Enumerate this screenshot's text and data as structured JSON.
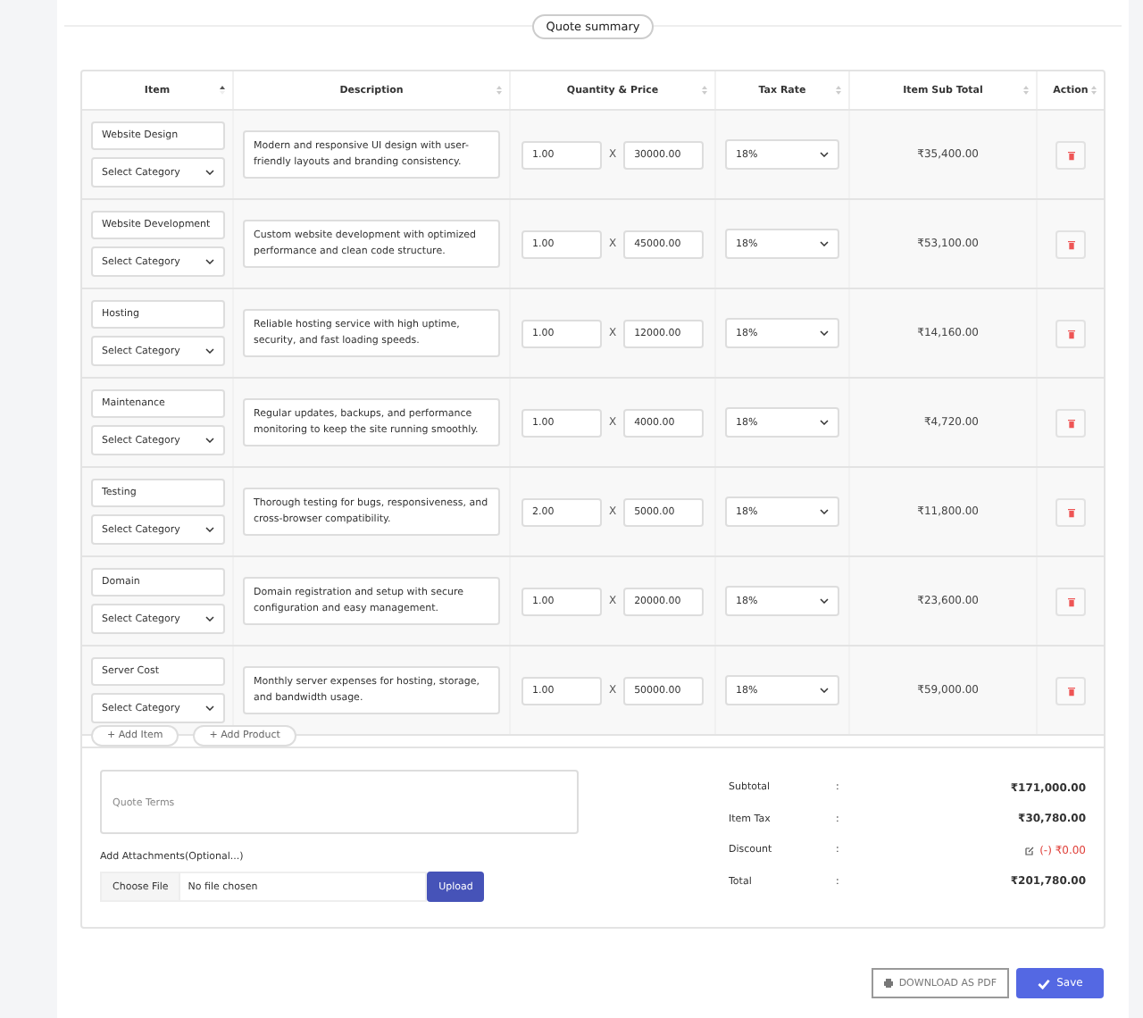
{
  "section_title": "Quote summary",
  "columns": [
    {
      "label": "Item",
      "sorted": true
    },
    {
      "label": "Description",
      "sorted": false
    },
    {
      "label": "Quantity & Price",
      "sorted": false
    },
    {
      "label": "Tax Rate",
      "sorted": false
    },
    {
      "label": "Item Sub Total",
      "sorted": false
    },
    {
      "label": "Action",
      "sorted": false
    }
  ],
  "rows": [
    {
      "item": "Website Design",
      "category": "Select Category",
      "description": "Modern and responsive UI design with user-friendly layouts and branding consistency.",
      "quantity": "1.00",
      "times": "X",
      "price": "30000.00",
      "tax": "18%",
      "subtotal": "₹35,400.00"
    },
    {
      "item": "Website Development",
      "category": "Select Category",
      "description": "Custom website development with optimized performance and clean code structure.",
      "quantity": "1.00",
      "times": "X",
      "price": "45000.00",
      "tax": "18%",
      "subtotal": "₹53,100.00"
    },
    {
      "item": "Hosting",
      "category": "Select Category",
      "description": "Reliable hosting service with high uptime, security, and fast loading speeds.",
      "quantity": "1.00",
      "times": "X",
      "price": "12000.00",
      "tax": "18%",
      "subtotal": "₹14,160.00"
    },
    {
      "item": "Maintenance",
      "category": "Select Category",
      "description": "Regular updates, backups, and performance monitoring to keep the site running smoothly.",
      "quantity": "1.00",
      "times": "X",
      "price": "4000.00",
      "tax": "18%",
      "subtotal": "₹4,720.00"
    },
    {
      "item": "Testing",
      "category": "Select Category",
      "description": "Thorough testing for bugs, responsiveness, and cross-browser compatibility.",
      "quantity": "2.00",
      "times": "X",
      "price": "5000.00",
      "tax": "18%",
      "subtotal": "₹11,800.00"
    },
    {
      "item": "Domain",
      "category": "Select Category",
      "description": "Domain registration and setup with secure configuration and easy management.",
      "quantity": "1.00",
      "times": "X",
      "price": "20000.00",
      "tax": "18%",
      "subtotal": "₹23,600.00"
    },
    {
      "item": "Server Cost",
      "category": "Select Category",
      "description": "Monthly server expenses for hosting, storage, and bandwidth usage.",
      "quantity": "1.00",
      "times": "X",
      "price": "50000.00",
      "tax": "18%",
      "subtotal": "₹59,000.00"
    }
  ],
  "add_buttons": [
    "+ Add Item",
    "+ Add Product"
  ],
  "terms": {
    "placeholder": "Quote Terms"
  },
  "attachments": {
    "label": "Add Attachments(Optional...)",
    "choose": "Choose File",
    "file": "No file chosen",
    "upload": "Upload"
  },
  "totals": [
    {
      "kind": "plain",
      "label": "Subtotal",
      "sep": ":",
      "value": "₹171,000.00"
    },
    {
      "kind": "plain",
      "label": "Item Tax",
      "sep": ":",
      "value": "₹30,780.00"
    },
    {
      "kind": "discount",
      "label": "Discount",
      "sep": ":",
      "value": "(-) ₹0.00"
    },
    {
      "kind": "plain",
      "label": "Total",
      "sep": ":",
      "value": "₹201,780.00"
    }
  ],
  "actions": {
    "download": "DOWNLOAD AS PDF",
    "save": "Save"
  }
}
